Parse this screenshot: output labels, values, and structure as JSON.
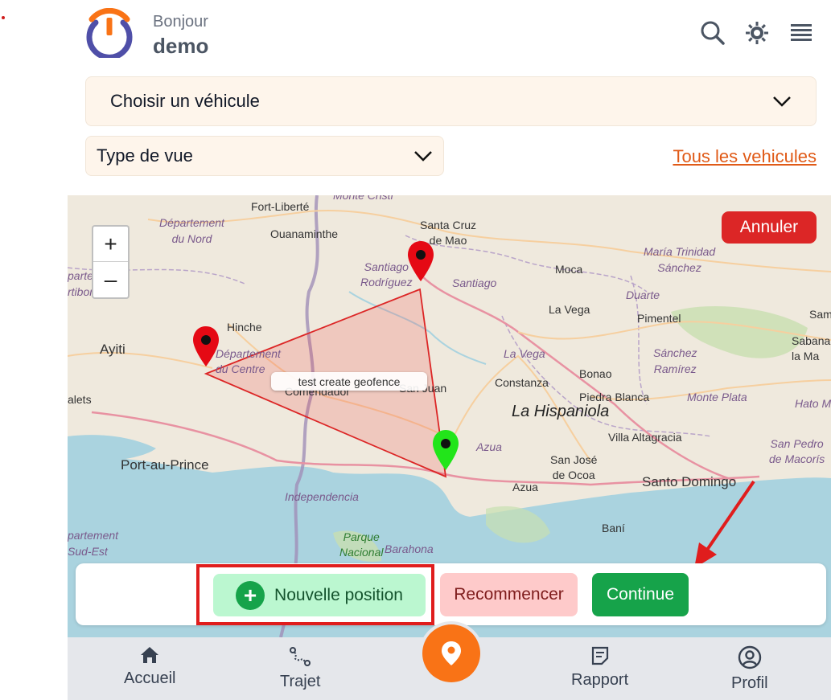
{
  "header": {
    "greeting": "Bonjour",
    "username": "demo",
    "icons": [
      "search-icon",
      "brightness-icon",
      "menu-icon"
    ]
  },
  "selectors": {
    "vehicle_placeholder": "Choisir un véhicule",
    "view_type_placeholder": "Type de vue",
    "all_vehicles_link": "Tous les vehicules"
  },
  "map": {
    "cancel_label": "Annuler",
    "zoom_in": "+",
    "zoom_out": "–",
    "geofence_label": "test create geofence",
    "labels": {
      "fort_liberte": "Fort-Liberté",
      "dept_nord": "Département\ndu Nord",
      "ouanaminthe": "Ouanaminthe",
      "santa_cruz": "Santa Cruz\nde Mao",
      "santiago_rodriguez": "Santiago\nRodríguez",
      "santiago": "Santiago",
      "moca": "Moca",
      "maria_trinidad": "María Trinidad\nSánchez",
      "partement_artibonite": "partement\nrtibonite",
      "hinche": "Hinche",
      "la_vega_city": "La Vega",
      "duarte": "Duarte",
      "pimentel": "Pimentel",
      "sam": "Sam",
      "sabana": "Sabana\nla Ma",
      "ayiti": "Ayiti",
      "dept_centre": "Département\ndu Centre",
      "la_vega": "La Vega",
      "sanchez_ramirez": "Sánchez\nRamírez",
      "bonao": "Bonao",
      "comendador": "Comendador",
      "san_juan": "San Juan",
      "constanza": "Constanza",
      "salets": "alets",
      "piedra_blanca": "Piedra Blanca",
      "monte_plata": "Monte Plata",
      "hato_ma": "Hato Ma",
      "la_hispaniola": "La Hispaniola",
      "villa_altagracia": "Villa Altagracia",
      "azua": "Azua",
      "san_pedro": "San Pedro\nde Macorís",
      "port_au_prince": "Port-au-Prince",
      "san_jose_ocoa": "San José\nde Ocoa",
      "santo_domingo": "Santo Domingo",
      "azua_city": "Azua",
      "independencia": "Independencia",
      "bani": "Baní",
      "partement_sud_est": "partement\nSud-Est",
      "parque_nacional": "Parque\nNacional",
      "barahona": "Barahona",
      "monte_cristi": "Monte Cristi"
    }
  },
  "actions": {
    "new_position": "Nouvelle position",
    "restart": "Recommencer",
    "continue": "Continue"
  },
  "nav": {
    "home": "Accueil",
    "trip": "Trajet",
    "report": "Rapport",
    "profile": "Profil"
  },
  "colors": {
    "accent_orange": "#f97316",
    "link_orange": "#e05a17",
    "danger_red": "#dc2626",
    "success_green": "#16a34a",
    "select_bg": "#fef5eb"
  }
}
